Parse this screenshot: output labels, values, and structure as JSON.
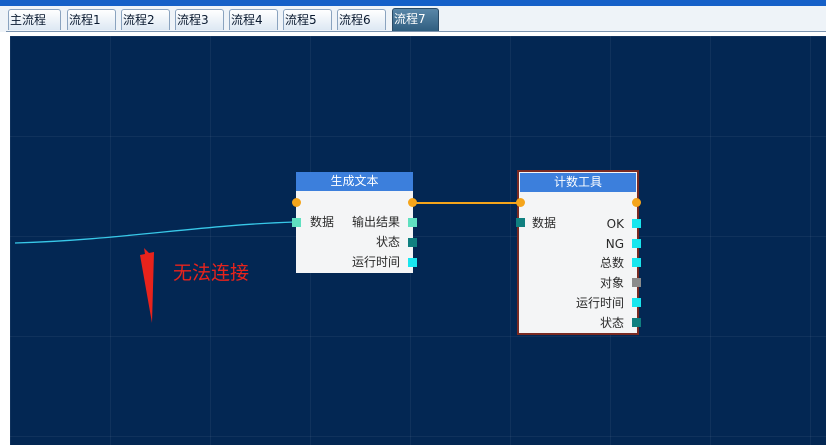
{
  "tabs": [
    "主流程",
    "流程1",
    "流程2",
    "流程3",
    "流程4",
    "流程5",
    "流程6",
    "流程7"
  ],
  "active_tab": "流程7",
  "nodes": {
    "gen_text": {
      "title": "生成文本",
      "input_label": "数据",
      "outputs": [
        "输出结果",
        "状态",
        "运行时间"
      ]
    },
    "counter": {
      "title": "计数工具",
      "input_label": "数据",
      "outputs": [
        "OK",
        "NG",
        "总数",
        "对象",
        "运行时间",
        "状态"
      ]
    }
  },
  "annotation": "无法连接",
  "colors": {
    "canvas_bg": "#032753",
    "node_header": "#3c7fdc",
    "connector_dot": "#f5a51b",
    "port_cyan": "#19e6ee",
    "port_teal": "#108080",
    "port_mint": "#5fe0c0",
    "port_gray": "#8c8c8c",
    "link_wire": "#f5a51b",
    "drag_wire": "#38c8e8",
    "annotation_red": "#e8231c",
    "selected_border": "#7a2a22"
  }
}
